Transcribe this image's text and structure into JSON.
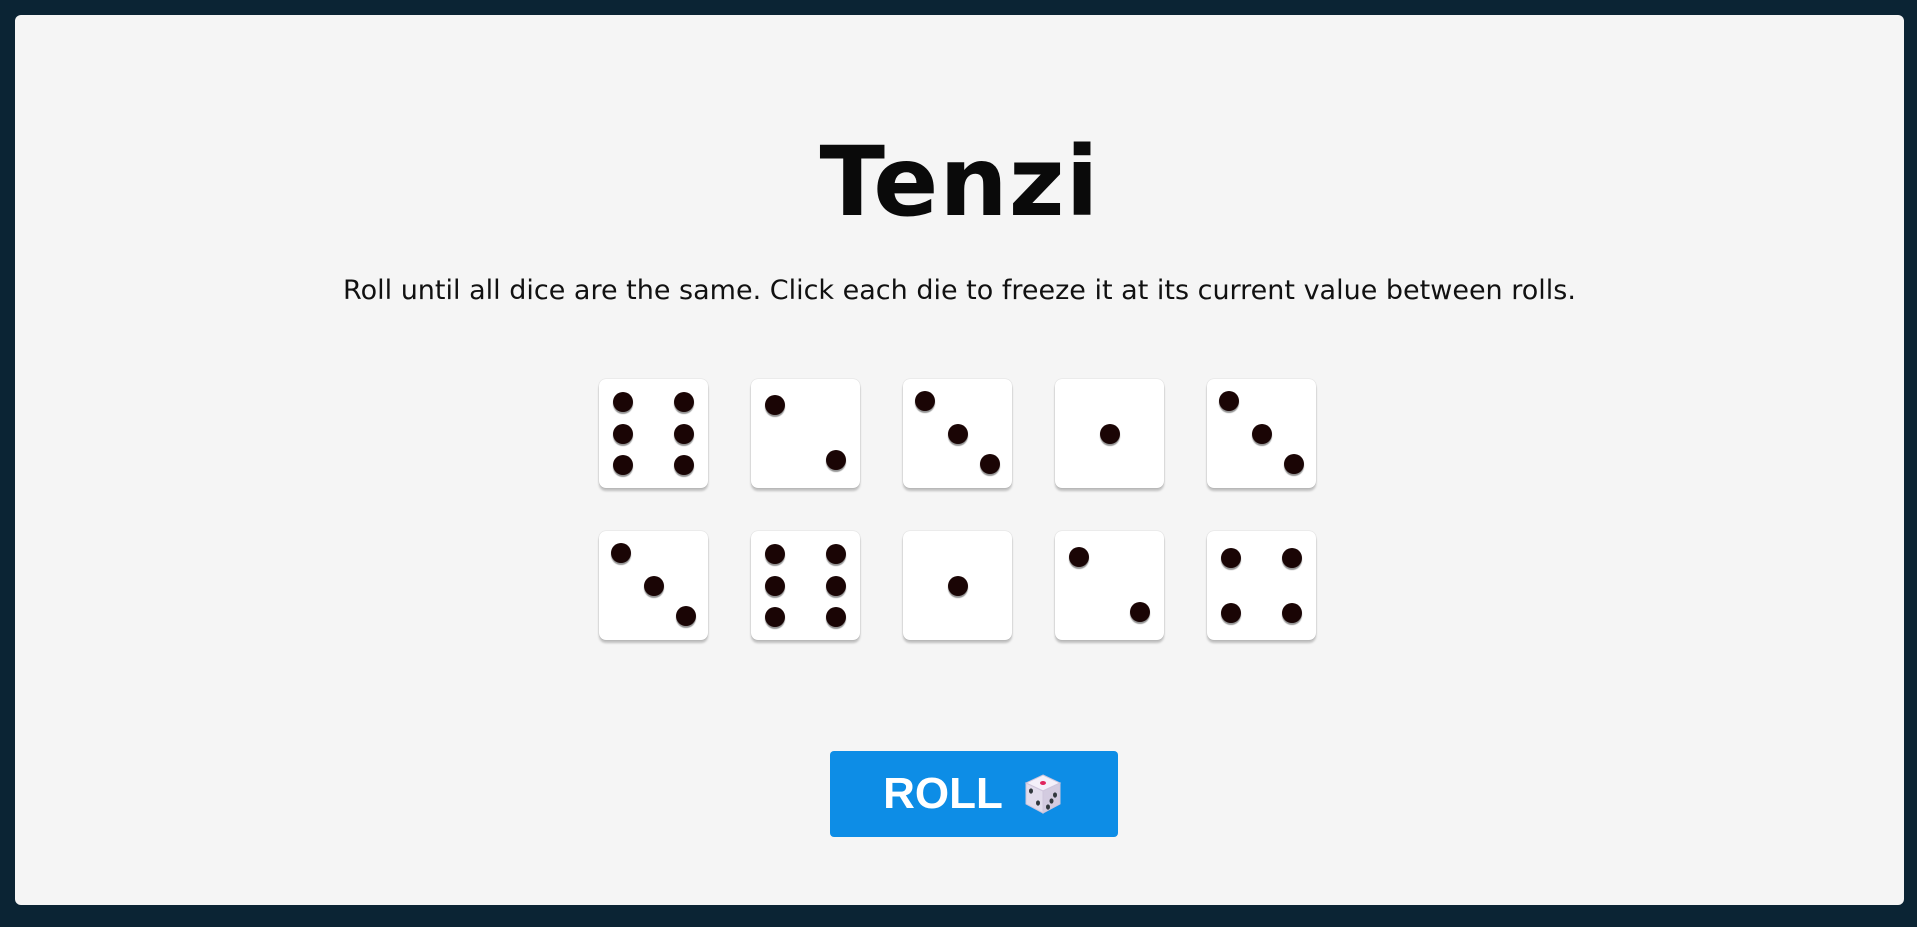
{
  "game": {
    "title": "Tenzi",
    "instructions": "Roll until all dice are the same. Click each die to freeze it at its current value between rolls.",
    "dice": [
      6,
      2,
      3,
      1,
      3,
      3,
      6,
      1,
      2,
      4
    ],
    "held": [
      false,
      false,
      false,
      false,
      false,
      false,
      false,
      false,
      false,
      false
    ],
    "roll_button": {
      "label": "ROLL",
      "icon": "game-die-icon"
    }
  },
  "colors": {
    "background": "#0b2434",
    "panel": "#f5f5f5",
    "die_face": "#ffffff",
    "pip": "#1a0505",
    "button": "#0d8de6",
    "button_text": "#ffffff"
  }
}
